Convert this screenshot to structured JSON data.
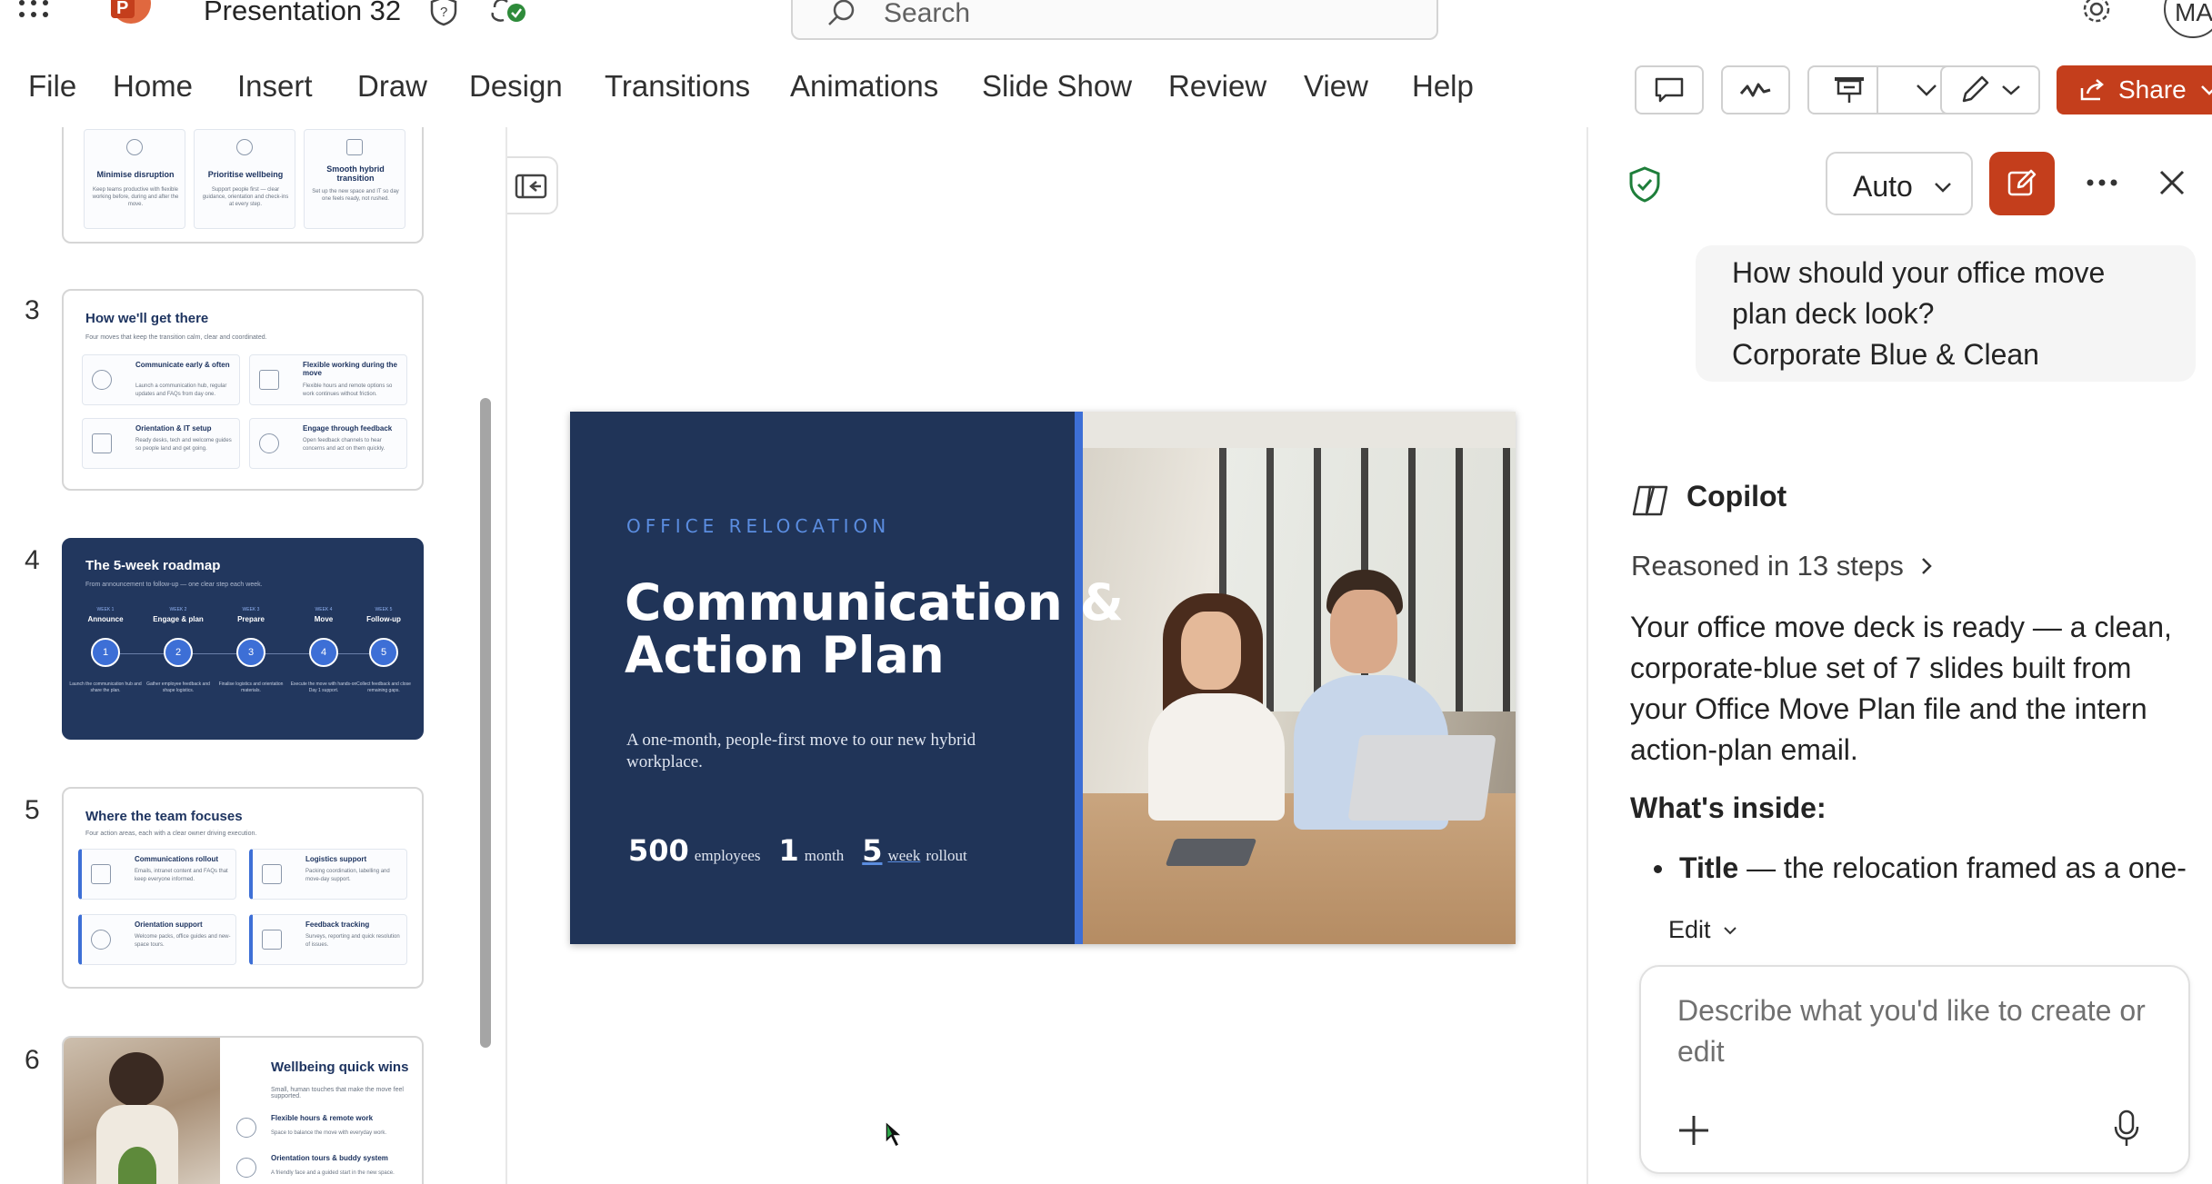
{
  "titlebar": {
    "doc_title": "Presentation 32",
    "search_placeholder": "Search",
    "avatar_initials": "MA"
  },
  "menu": {
    "items": [
      "File",
      "Home",
      "Insert",
      "Draw",
      "Design",
      "Transitions",
      "Animations",
      "Slide Show",
      "Review",
      "View",
      "Help"
    ],
    "share_label": "Share"
  },
  "thumbnails": {
    "slide2": {
      "cards": [
        {
          "title": "Minimise disruption",
          "text": "Keep teams productive with flexible working before, during and after the move."
        },
        {
          "title": "Prioritise wellbeing",
          "text": "Support people first — clear guidance, orientation and check-ins at every step."
        },
        {
          "title": "Smooth hybrid transition",
          "text": "Set up the new space and IT so day one feels ready, not rushed."
        }
      ]
    },
    "slide3": {
      "number": "3",
      "title": "How we'll get there",
      "subtitle": "Four moves that keep the transition calm, clear and coordinated.",
      "cards": [
        {
          "title": "Communicate early & often",
          "text": "Launch a communication hub, regular updates and FAQs from day one."
        },
        {
          "title": "Flexible working during the move",
          "text": "Flexible hours and remote options so work continues without friction."
        },
        {
          "title": "Orientation & IT setup",
          "text": "Ready desks, tech and welcome guides so people land and get going."
        },
        {
          "title": "Engage through feedback",
          "text": "Open feedback channels to hear concerns and act on them quickly."
        }
      ]
    },
    "slide4": {
      "number": "4",
      "title": "The 5-week roadmap",
      "subtitle": "From announcement to follow-up — one clear step each week.",
      "steps": [
        {
          "week": "WEEK 1",
          "label": "Announce",
          "num": "1",
          "text": "Launch the communication hub and share the plan."
        },
        {
          "week": "WEEK 2",
          "label": "Engage & plan",
          "num": "2",
          "text": "Gather employee feedback and shape logistics."
        },
        {
          "week": "WEEK 3",
          "label": "Prepare",
          "num": "3",
          "text": "Finalise logistics and orientation materials."
        },
        {
          "week": "WEEK 4",
          "label": "Move",
          "num": "4",
          "text": "Execute the move with hands-on Day 1 support."
        },
        {
          "week": "WEEK 5",
          "label": "Follow-up",
          "num": "5",
          "text": "Collect feedback and close remaining gaps."
        }
      ]
    },
    "slide5": {
      "number": "5",
      "title": "Where the team focuses",
      "subtitle": "Four action areas, each with a clear owner driving execution.",
      "cards": [
        {
          "title": "Communications rollout",
          "text": "Emails, intranet content and FAQs that keep everyone informed."
        },
        {
          "title": "Logistics support",
          "text": "Packing coordination, labelling and move-day support."
        },
        {
          "title": "Orientation support",
          "text": "Welcome packs, office guides and new-space tours."
        },
        {
          "title": "Feedback tracking",
          "text": "Surveys, reporting and quick resolution of issues."
        }
      ]
    },
    "slide6": {
      "number": "6",
      "title": "Wellbeing quick wins",
      "subtitle": "Small, human touches that make the move feel supported.",
      "items": [
        {
          "title": "Flexible hours & remote work",
          "text": "Space to balance the move with everyday work."
        },
        {
          "title": "Orientation tours & buddy system",
          "text": "A friendly face and a guided start in the new space."
        }
      ]
    }
  },
  "slide": {
    "eyebrow": "OFFICE RELOCATION",
    "title_line1": "Communication &",
    "title_line2": "Action Plan",
    "subtitle": "A one-month, people-first move to our new hybrid workplace.",
    "stats": [
      {
        "value": "500",
        "label": "employees"
      },
      {
        "value": "1",
        "label": "month"
      },
      {
        "value": "5",
        "label": "week",
        "label2": "rollout"
      }
    ]
  },
  "copilot": {
    "mode": "Auto",
    "user_message_line1": "How should your office move",
    "user_message_line2": "plan deck look?",
    "user_message_line3": "Corporate Blue & Clean",
    "assistant_name": "Copilot",
    "reasoned": "Reasoned in 13 steps",
    "response_lines": [
      "Your office move deck is ready — a clean,",
      "corporate-blue set of 7 slides built from",
      "your Office Move Plan file and the intern",
      "action-plan email."
    ],
    "whats_inside": "What's inside:",
    "bullet_bold": "Title",
    "bullet_rest": " — the relocation framed as a one-",
    "edit_label": "Edit",
    "input_placeholder_line1": "Describe what you'd like to create or",
    "input_placeholder_line2": "edit"
  },
  "colors": {
    "accent": "#c43e1c",
    "slide_navy": "#203458",
    "slide_accent_blue": "#3d6fd6"
  }
}
